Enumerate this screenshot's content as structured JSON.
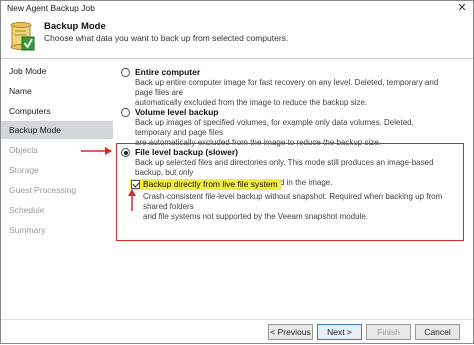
{
  "window": {
    "title": "New Agent Backup Job",
    "close_glyph": "✕"
  },
  "header": {
    "title": "Backup Mode",
    "subtitle": "Choose what data you want to back up from selected computers.",
    "icon": "scroll-checkmark-icon"
  },
  "sidebar": {
    "items": [
      {
        "label": "Job Mode",
        "state": "normal"
      },
      {
        "label": "Name",
        "state": "normal"
      },
      {
        "label": "Computers",
        "state": "normal"
      },
      {
        "label": "Backup Mode",
        "state": "active"
      },
      {
        "label": "Objects",
        "state": "disabled"
      },
      {
        "label": "Storage",
        "state": "disabled"
      },
      {
        "label": "Guest Processing",
        "state": "disabled"
      },
      {
        "label": "Schedule",
        "state": "disabled"
      },
      {
        "label": "Summary",
        "state": "disabled"
      }
    ]
  },
  "options": [
    {
      "label": "Entire computer",
      "checked": false,
      "desc1": "Back up entire computer image for fast recovery on any level. Deleted, temporary and page files are",
      "desc2": "automatically excluded from the image to reduce the backup size."
    },
    {
      "label": "Volume level backup",
      "checked": false,
      "desc1": "Back up images of specified volumes, for example only data volumes. Deleted, temporary and page files",
      "desc2": "are automatically excluded from the image to reduce the backup size."
    },
    {
      "label": "File level backup (slower)",
      "checked": true,
      "desc1": "Back up selected files and directories only. This mode still produces an image-based backup, but only",
      "desc2": "with protected file system objects included in the image."
    }
  ],
  "live_fs": {
    "label": "Backup directly from live file system",
    "checked": true,
    "desc1": "Crash-consistent file-level backup without snapshot. Required when backing up from shared folders",
    "desc2": "and file systems not supported by the Veeam snapshot module."
  },
  "buttons": {
    "previous": "< Previous",
    "next": "Next >",
    "finish": "Finish",
    "cancel": "Cancel"
  },
  "colors": {
    "annotation": "#d52b2b",
    "highlight": "#f5ef3a",
    "active_nav": "#d3d6db"
  }
}
